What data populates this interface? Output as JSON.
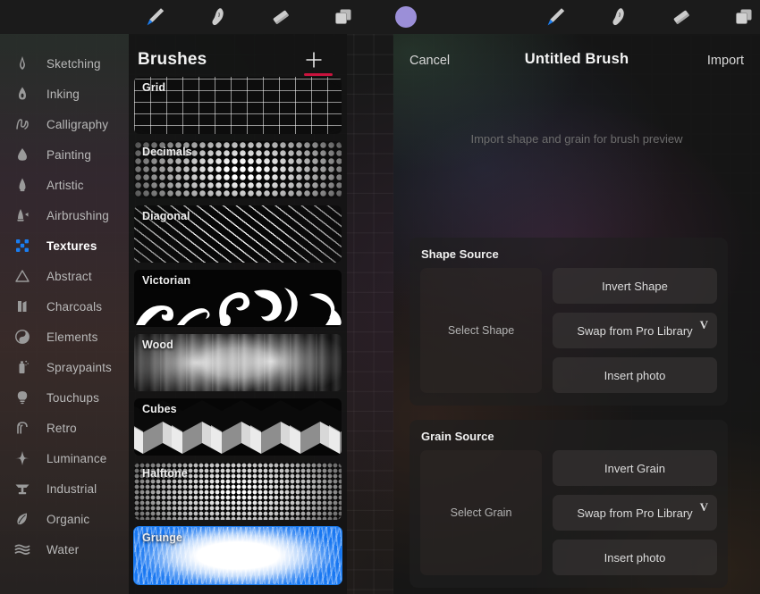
{
  "toolbar": {
    "left_tools": [
      {
        "name": "paintbrush-tool",
        "icon": "paintbrush-icon",
        "active": true
      },
      {
        "name": "smudge-tool",
        "icon": "smudge-icon",
        "active": false
      },
      {
        "name": "eraser-tool",
        "icon": "eraser-icon",
        "active": false
      },
      {
        "name": "layers-tool",
        "icon": "layers-icon",
        "active": false
      },
      {
        "name": "color-swatch",
        "icon": "color-circle-icon",
        "active": false
      }
    ],
    "right_tools": [
      {
        "name": "paintbrush-tool",
        "icon": "paintbrush-icon",
        "active": true
      },
      {
        "name": "smudge-tool",
        "icon": "smudge-icon",
        "active": false
      },
      {
        "name": "eraser-tool",
        "icon": "eraser-icon",
        "active": false
      },
      {
        "name": "layers-tool",
        "icon": "layers-icon",
        "active": false
      }
    ],
    "color": "#9b8fd8",
    "accent": "#1a7df0"
  },
  "sidebar": {
    "items": [
      {
        "label": "Sketching",
        "icon": "pencil-tip-icon",
        "active": false
      },
      {
        "label": "Inking",
        "icon": "ink-nib-icon",
        "active": false
      },
      {
        "label": "Calligraphy",
        "icon": "script-n-icon",
        "active": false
      },
      {
        "label": "Painting",
        "icon": "paint-drop-icon",
        "active": false
      },
      {
        "label": "Artistic",
        "icon": "flame-drop-icon",
        "active": false
      },
      {
        "label": "Airbrushing",
        "icon": "airbrush-icon",
        "active": false
      },
      {
        "label": "Textures",
        "icon": "texture-dots-icon",
        "active": true
      },
      {
        "label": "Abstract",
        "icon": "triangle-icon",
        "active": false
      },
      {
        "label": "Charcoals",
        "icon": "charcoal-icon",
        "active": false
      },
      {
        "label": "Elements",
        "icon": "yin-yang-icon",
        "active": false
      },
      {
        "label": "Spraypaints",
        "icon": "spray-can-icon",
        "active": false
      },
      {
        "label": "Touchups",
        "icon": "lightbulb-icon",
        "active": false
      },
      {
        "label": "Retro",
        "icon": "retro-arc-icon",
        "active": false
      },
      {
        "label": "Luminance",
        "icon": "sparkle-icon",
        "active": false
      },
      {
        "label": "Industrial",
        "icon": "anvil-icon",
        "active": false
      },
      {
        "label": "Organic",
        "icon": "leaf-icon",
        "active": false
      },
      {
        "label": "Water",
        "icon": "waves-icon",
        "active": false
      }
    ]
  },
  "brushes": {
    "title": "Brushes",
    "add_button": "add-brush-plus",
    "underline_color": "#c8133d",
    "items": [
      {
        "name": "Grid",
        "thumb": "th-grid",
        "selected": false
      },
      {
        "name": "Decimals",
        "thumb": "th-decimals",
        "selected": false
      },
      {
        "name": "Diagonal",
        "thumb": "th-diagonal",
        "selected": false
      },
      {
        "name": "Victorian",
        "thumb": "th-victorian",
        "selected": false
      },
      {
        "name": "Wood",
        "thumb": "th-wood",
        "selected": false
      },
      {
        "name": "Cubes",
        "thumb": "th-cubes",
        "selected": false
      },
      {
        "name": "Halftone",
        "thumb": "th-halftone",
        "selected": false
      },
      {
        "name": "Grunge",
        "thumb": "th-grunge",
        "selected": true
      }
    ]
  },
  "detail": {
    "cancel_label": "Cancel",
    "title": "Untitled Brush",
    "import_label": "Import",
    "preview_hint": "Import shape and grain for brush preview",
    "shape_source": {
      "title": "Shape Source",
      "select_label": "Select Shape",
      "buttons": [
        {
          "label": "Invert Shape",
          "mark": ""
        },
        {
          "label": "Swap from Pro Library",
          "mark": "V"
        },
        {
          "label": "Insert photo",
          "mark": ""
        }
      ]
    },
    "grain_source": {
      "title": "Grain Source",
      "select_label": "Select Grain",
      "buttons": [
        {
          "label": "Invert Grain",
          "mark": ""
        },
        {
          "label": "Swap from Pro Library",
          "mark": "V"
        },
        {
          "label": "Insert photo",
          "mark": ""
        }
      ]
    },
    "mark_color": "#cf0f3d"
  }
}
